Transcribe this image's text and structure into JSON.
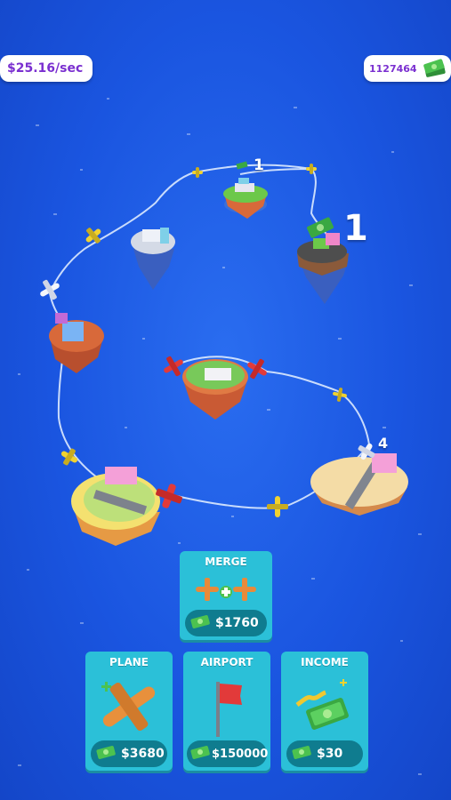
{
  "hud": {
    "income_rate": "$25.16/sec",
    "balance": "1127464",
    "balance_icon": "cash-stack-icon"
  },
  "route_levels": {
    "top": "1",
    "right": "1",
    "bottom_right": "4"
  },
  "buttons": {
    "merge": {
      "title": "MERGE",
      "price": "$1760"
    },
    "plane": {
      "title": "PLANE",
      "price": "$3680"
    },
    "airport": {
      "title": "AIRPORT",
      "price": "$150000"
    },
    "income": {
      "title": "INCOME",
      "price": "$30"
    }
  },
  "colors": {
    "sea": "#1a55e0",
    "button": "#2bc0d8",
    "price_pill": "#0f7c8f",
    "hud_text": "#7a2fd0",
    "cash": "#3aa842"
  }
}
